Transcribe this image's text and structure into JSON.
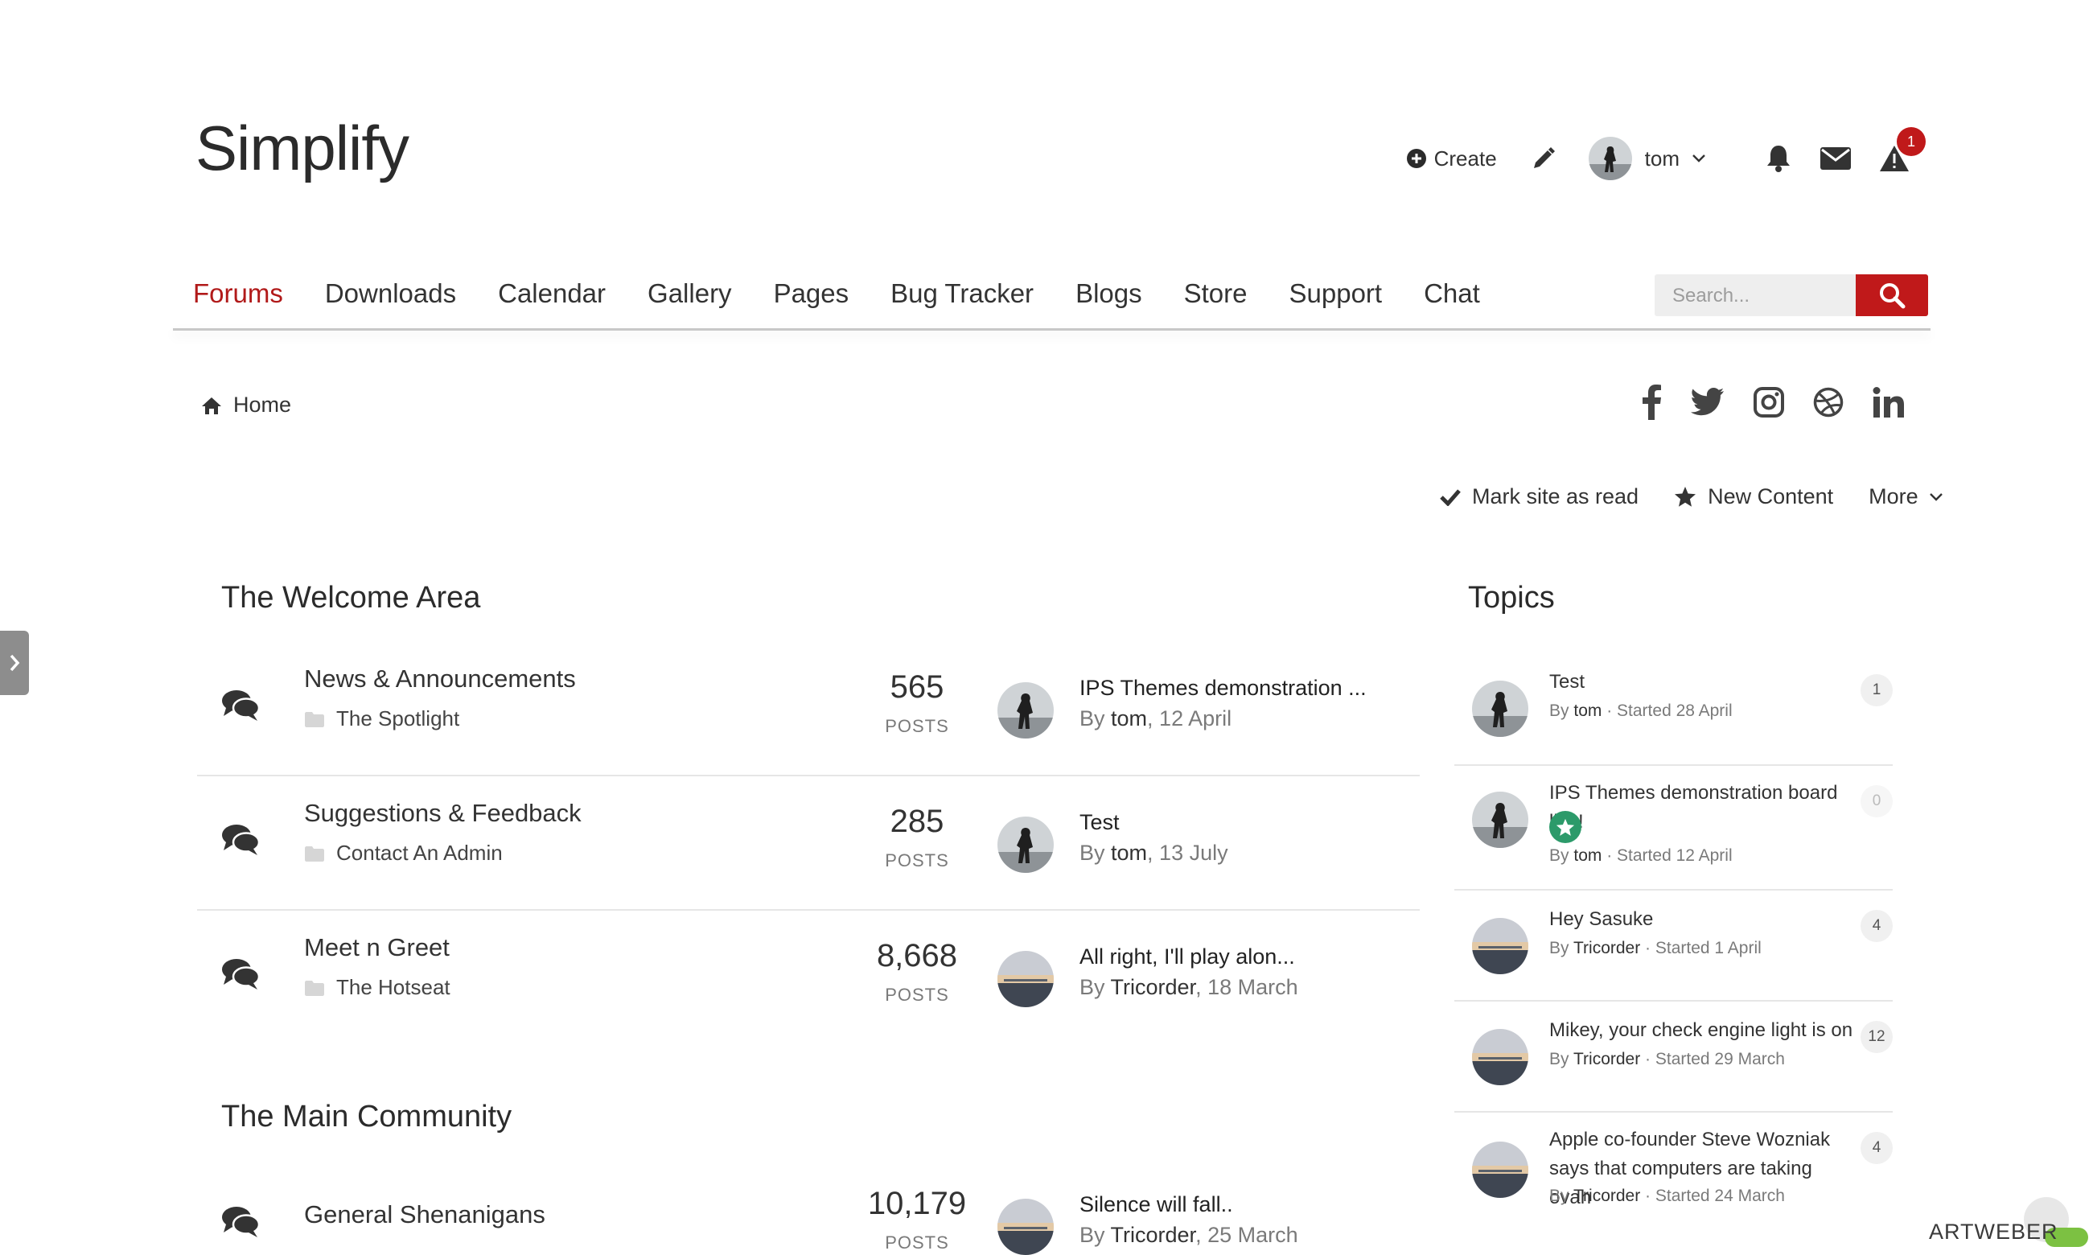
{
  "brand": {
    "logo": "Simplify"
  },
  "user_bar": {
    "create_label": "Create",
    "username": "tom",
    "alert_count": "1"
  },
  "nav": {
    "items": [
      "Forums",
      "Downloads",
      "Calendar",
      "Gallery",
      "Pages",
      "Bug Tracker",
      "Blogs",
      "Store",
      "Support",
      "Chat"
    ],
    "active": "Forums"
  },
  "search": {
    "placeholder": "Search..."
  },
  "breadcrumb": {
    "home": "Home"
  },
  "social": [
    "facebook-icon",
    "twitter-icon",
    "instagram-icon",
    "dribbble-icon",
    "linkedin-icon"
  ],
  "actions": {
    "mark_read": "Mark site as read",
    "new_content": "New Content",
    "more": "More"
  },
  "sections": [
    {
      "title": "The Welcome Area",
      "forums": [
        {
          "name": "News & Announcements",
          "sub": "The Spotlight",
          "count": "565",
          "unit": "POSTS",
          "last_title": "IPS Themes demonstration ...",
          "last_by": "By",
          "last_user": "tom",
          "last_date": ", 12 April"
        },
        {
          "name": "Suggestions & Feedback",
          "sub": "Contact An Admin",
          "count": "285",
          "unit": "POSTS",
          "last_title": "Test",
          "last_by": "By",
          "last_user": "tom",
          "last_date": ", 13 July"
        },
        {
          "name": "Meet n Greet",
          "sub": "The Hotseat",
          "count": "8,668",
          "unit": "POSTS",
          "last_title": "All right, I'll play alon...",
          "last_by": "By",
          "last_user": "Tricorder",
          "last_date": ", 18 March"
        }
      ]
    },
    {
      "title": "The Main Community",
      "forums": [
        {
          "name": "General Shenanigans",
          "count": "10,179",
          "unit": "POSTS",
          "last_title": "Silence will fall..",
          "last_by": "By",
          "last_user": "Tricorder",
          "last_date": ", 25 March"
        }
      ]
    }
  ],
  "topics": {
    "title": "Topics",
    "items": [
      {
        "title": "Test",
        "by": "By",
        "user": "tom",
        "started": " · Started 28 April",
        "count": "1"
      },
      {
        "title": "IPS Themes demonstration board live!",
        "by": "By",
        "user": "tom",
        "started": " · Started 12 April",
        "count": "0",
        "featured": true
      },
      {
        "title": "Hey Sasuke",
        "by": "By",
        "user": "Tricorder",
        "started": " · Started 1 April",
        "count": "4"
      },
      {
        "title": "Mikey, your check engine light is on",
        "by": "By",
        "user": "Tricorder",
        "started": " · Started 29 March",
        "count": "12"
      },
      {
        "title": "Apple co-founder Steve Wozniak says that computers are taking ovah",
        "by": "By",
        "user": "Tricorder",
        "started": " · Started 24 March",
        "count": "4"
      }
    ]
  },
  "watermark": "ARTWEBER",
  "colors": {
    "accent": "#c0191a",
    "active_nav": "#b11a1a",
    "featured": "#2c9a6a"
  }
}
